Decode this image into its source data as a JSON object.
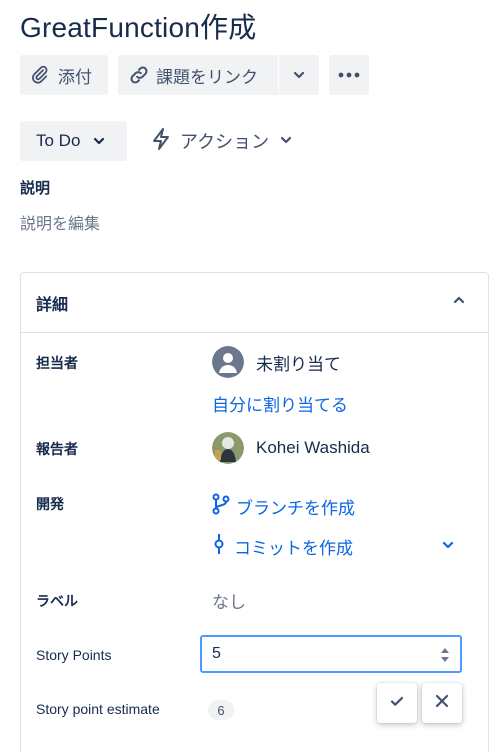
{
  "issue": {
    "title": "GreatFunction作成"
  },
  "toolbar": {
    "attach_label": "添付",
    "link_issue_label": "課題をリンク"
  },
  "status": {
    "label": "To Do",
    "actions_label": "アクション"
  },
  "description": {
    "heading": "説明",
    "edit_placeholder": "説明を編集"
  },
  "details": {
    "heading": "詳細",
    "assignee": {
      "label": "担当者",
      "value": "未割り当て",
      "assign_to_me": "自分に割り当てる"
    },
    "reporter": {
      "label": "報告者",
      "value": "Kohei Washida"
    },
    "development": {
      "label": "開発",
      "create_branch": "ブランチを作成",
      "create_commit": "コミットを作成"
    },
    "labels": {
      "label": "ラベル",
      "value": "なし"
    },
    "story_points": {
      "label": "Story Points",
      "value": "5"
    },
    "story_point_estimate": {
      "label": "Story point estimate",
      "value": "6"
    }
  },
  "colors": {
    "link": "#0c66e4",
    "focus": "#4c9aff",
    "text": "#172b4d",
    "button_bg": "#f1f2f4"
  }
}
